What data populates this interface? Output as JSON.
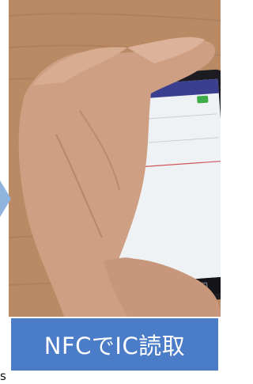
{
  "photo": {
    "subject": "hand-holding-tablet",
    "colors": {
      "wood": "#b98a64",
      "skin": "#cf9f83",
      "skin_shadow": "#a9765d",
      "bezel": "#1c1c22",
      "screen": "#eef2f4",
      "app_bar": "#3b3f8f",
      "accent_green": "#3fae4a",
      "divider_red": "#d0545a"
    }
  },
  "caption": {
    "text": "NFCでIC読取",
    "background": "#4a7cc7",
    "color": "#ffffff"
  },
  "edge_glyph": "s"
}
